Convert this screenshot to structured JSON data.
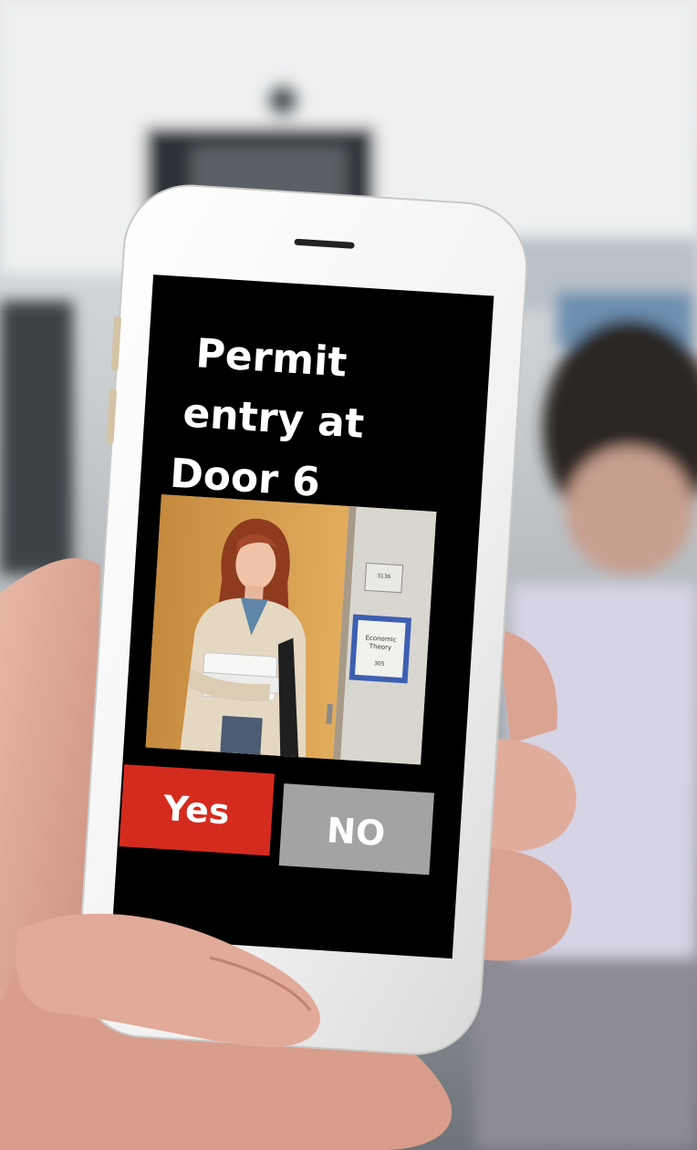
{
  "prompt": {
    "line1": "Permit",
    "line2": "entry at",
    "line3": "Door 6"
  },
  "actions": {
    "yes_label": "Yes",
    "no_label": "NO"
  },
  "door_sign": {
    "room_number": "3136",
    "name_line1": "Economic",
    "name_line2": "Theory",
    "name_line3": "305"
  },
  "colors": {
    "screen": "#000000",
    "yes_button": "#d52b1e",
    "no_button": "#a3a3a3",
    "text": "#ffffff"
  }
}
